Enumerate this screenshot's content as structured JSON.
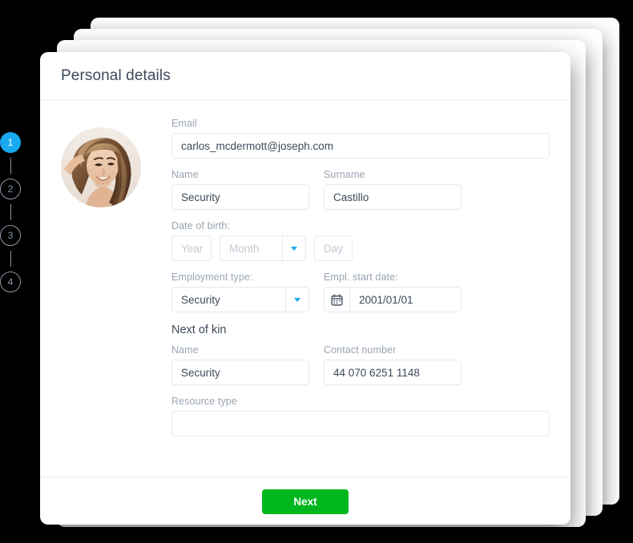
{
  "card": {
    "title": "Personal details"
  },
  "avatar": {
    "alt": "user-profile-photo"
  },
  "stepper": {
    "steps": [
      {
        "label": "1",
        "state": "active"
      },
      {
        "label": "2",
        "state": "inactive"
      },
      {
        "label": "3",
        "state": "inactive"
      },
      {
        "label": "4",
        "state": "inactive"
      }
    ]
  },
  "form": {
    "email": {
      "label": "Email",
      "value": "carlos_mcdermott@joseph.com"
    },
    "name": {
      "label": "Name",
      "value": "Security"
    },
    "surname": {
      "label": "Surname",
      "value": "Castillo"
    },
    "date_of_birth": {
      "label": "Date of birth:",
      "year_placeholder": "Year",
      "month_placeholder": "Month",
      "day_placeholder": "Day"
    },
    "employment_type": {
      "label": "Employment type:",
      "value": "Security"
    },
    "employment_start_date": {
      "label": "Empl. start date:",
      "value": "2001/01/01"
    },
    "next_of_kin": {
      "heading": "Next of kin",
      "name": {
        "label": "Name",
        "value": "Security"
      },
      "contact_number": {
        "label": "Contact number",
        "value": "44 070 6251 1148"
      }
    },
    "resource_type": {
      "label": "Resource type",
      "value": ""
    }
  },
  "footer": {
    "next_label": "Next"
  },
  "colors": {
    "accent_blue": "#19a9f0",
    "next_green": "#00b81e",
    "label_gray": "#9aa4b2",
    "text_dark": "#3e4a5a",
    "border": "#e6e9ef"
  }
}
